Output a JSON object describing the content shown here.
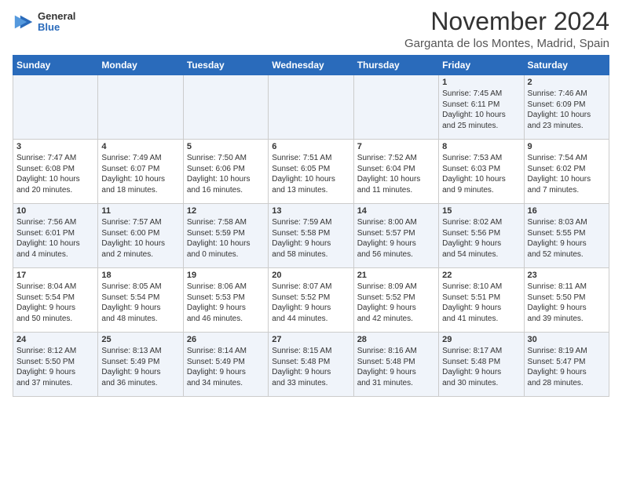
{
  "header": {
    "logo_general": "General",
    "logo_blue": "Blue",
    "month_title": "November 2024",
    "location": "Garganta de los Montes, Madrid, Spain"
  },
  "weekdays": [
    "Sunday",
    "Monday",
    "Tuesday",
    "Wednesday",
    "Thursday",
    "Friday",
    "Saturday"
  ],
  "weeks": [
    [
      {
        "day": "",
        "info": ""
      },
      {
        "day": "",
        "info": ""
      },
      {
        "day": "",
        "info": ""
      },
      {
        "day": "",
        "info": ""
      },
      {
        "day": "",
        "info": ""
      },
      {
        "day": "1",
        "info": "Sunrise: 7:45 AM\nSunset: 6:11 PM\nDaylight: 10 hours\nand 25 minutes."
      },
      {
        "day": "2",
        "info": "Sunrise: 7:46 AM\nSunset: 6:09 PM\nDaylight: 10 hours\nand 23 minutes."
      }
    ],
    [
      {
        "day": "3",
        "info": "Sunrise: 7:47 AM\nSunset: 6:08 PM\nDaylight: 10 hours\nand 20 minutes."
      },
      {
        "day": "4",
        "info": "Sunrise: 7:49 AM\nSunset: 6:07 PM\nDaylight: 10 hours\nand 18 minutes."
      },
      {
        "day": "5",
        "info": "Sunrise: 7:50 AM\nSunset: 6:06 PM\nDaylight: 10 hours\nand 16 minutes."
      },
      {
        "day": "6",
        "info": "Sunrise: 7:51 AM\nSunset: 6:05 PM\nDaylight: 10 hours\nand 13 minutes."
      },
      {
        "day": "7",
        "info": "Sunrise: 7:52 AM\nSunset: 6:04 PM\nDaylight: 10 hours\nand 11 minutes."
      },
      {
        "day": "8",
        "info": "Sunrise: 7:53 AM\nSunset: 6:03 PM\nDaylight: 10 hours\nand 9 minutes."
      },
      {
        "day": "9",
        "info": "Sunrise: 7:54 AM\nSunset: 6:02 PM\nDaylight: 10 hours\nand 7 minutes."
      }
    ],
    [
      {
        "day": "10",
        "info": "Sunrise: 7:56 AM\nSunset: 6:01 PM\nDaylight: 10 hours\nand 4 minutes."
      },
      {
        "day": "11",
        "info": "Sunrise: 7:57 AM\nSunset: 6:00 PM\nDaylight: 10 hours\nand 2 minutes."
      },
      {
        "day": "12",
        "info": "Sunrise: 7:58 AM\nSunset: 5:59 PM\nDaylight: 10 hours\nand 0 minutes."
      },
      {
        "day": "13",
        "info": "Sunrise: 7:59 AM\nSunset: 5:58 PM\nDaylight: 9 hours\nand 58 minutes."
      },
      {
        "day": "14",
        "info": "Sunrise: 8:00 AM\nSunset: 5:57 PM\nDaylight: 9 hours\nand 56 minutes."
      },
      {
        "day": "15",
        "info": "Sunrise: 8:02 AM\nSunset: 5:56 PM\nDaylight: 9 hours\nand 54 minutes."
      },
      {
        "day": "16",
        "info": "Sunrise: 8:03 AM\nSunset: 5:55 PM\nDaylight: 9 hours\nand 52 minutes."
      }
    ],
    [
      {
        "day": "17",
        "info": "Sunrise: 8:04 AM\nSunset: 5:54 PM\nDaylight: 9 hours\nand 50 minutes."
      },
      {
        "day": "18",
        "info": "Sunrise: 8:05 AM\nSunset: 5:54 PM\nDaylight: 9 hours\nand 48 minutes."
      },
      {
        "day": "19",
        "info": "Sunrise: 8:06 AM\nSunset: 5:53 PM\nDaylight: 9 hours\nand 46 minutes."
      },
      {
        "day": "20",
        "info": "Sunrise: 8:07 AM\nSunset: 5:52 PM\nDaylight: 9 hours\nand 44 minutes."
      },
      {
        "day": "21",
        "info": "Sunrise: 8:09 AM\nSunset: 5:52 PM\nDaylight: 9 hours\nand 42 minutes."
      },
      {
        "day": "22",
        "info": "Sunrise: 8:10 AM\nSunset: 5:51 PM\nDaylight: 9 hours\nand 41 minutes."
      },
      {
        "day": "23",
        "info": "Sunrise: 8:11 AM\nSunset: 5:50 PM\nDaylight: 9 hours\nand 39 minutes."
      }
    ],
    [
      {
        "day": "24",
        "info": "Sunrise: 8:12 AM\nSunset: 5:50 PM\nDaylight: 9 hours\nand 37 minutes."
      },
      {
        "day": "25",
        "info": "Sunrise: 8:13 AM\nSunset: 5:49 PM\nDaylight: 9 hours\nand 36 minutes."
      },
      {
        "day": "26",
        "info": "Sunrise: 8:14 AM\nSunset: 5:49 PM\nDaylight: 9 hours\nand 34 minutes."
      },
      {
        "day": "27",
        "info": "Sunrise: 8:15 AM\nSunset: 5:48 PM\nDaylight: 9 hours\nand 33 minutes."
      },
      {
        "day": "28",
        "info": "Sunrise: 8:16 AM\nSunset: 5:48 PM\nDaylight: 9 hours\nand 31 minutes."
      },
      {
        "day": "29",
        "info": "Sunrise: 8:17 AM\nSunset: 5:48 PM\nDaylight: 9 hours\nand 30 minutes."
      },
      {
        "day": "30",
        "info": "Sunrise: 8:19 AM\nSunset: 5:47 PM\nDaylight: 9 hours\nand 28 minutes."
      }
    ]
  ]
}
